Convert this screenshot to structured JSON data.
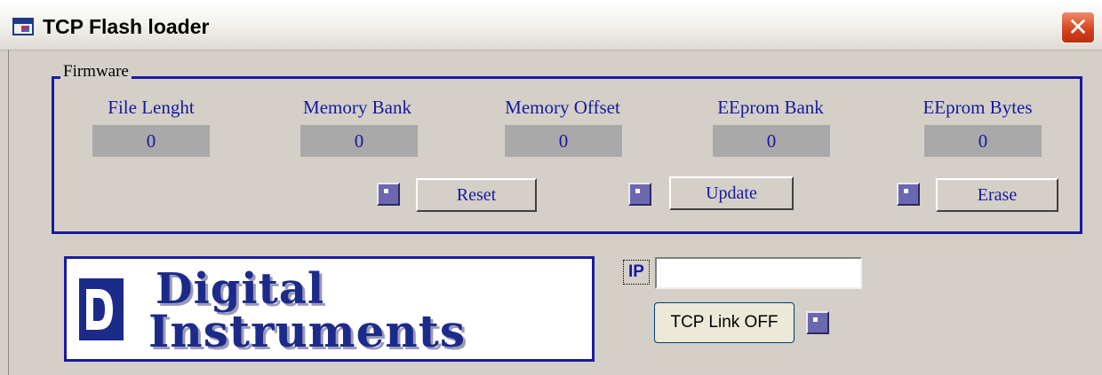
{
  "window": {
    "title": "TCP Flash loader",
    "close_label": "✕"
  },
  "firmware": {
    "legend": "Firmware",
    "fields": [
      {
        "label": "File Lenght",
        "value": "0"
      },
      {
        "label": "Memory Bank",
        "value": "0"
      },
      {
        "label": "Memory Offset",
        "value": "0"
      },
      {
        "label": "EEprom Bank",
        "value": "0"
      },
      {
        "label": "EEprom Bytes",
        "value": "0"
      }
    ],
    "buttons": {
      "reset": "Reset",
      "update": "Update",
      "erase": "Erase"
    }
  },
  "logo": {
    "line1": "Digital",
    "line2": "Instruments"
  },
  "connection": {
    "ip_label": "IP",
    "ip_value": "",
    "tcp_button": "TCP Link OFF"
  },
  "colors": {
    "accent": "#1a1aa0",
    "label_text": "#1818a0",
    "value_bg": "#a9a9a9",
    "window_bg": "#d4d0c8"
  },
  "icons": {
    "app": "app-window-icon",
    "close": "close-icon",
    "led": "led-indicator-icon"
  }
}
